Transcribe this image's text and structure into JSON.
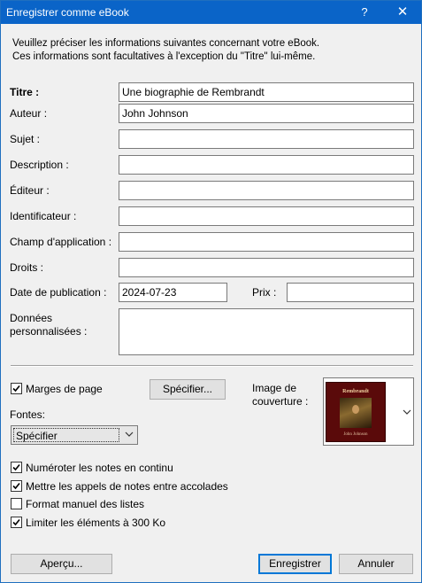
{
  "window": {
    "title": "Enregistrer comme eBook",
    "help_label": "?",
    "close_label": "✕"
  },
  "intro": {
    "line1": "Veuillez préciser les informations suivantes concernant votre eBook.",
    "line2": "Ces informations sont facultatives à l'exception du \"Titre\" lui-même."
  },
  "fields": {
    "titre": {
      "label": "Titre :",
      "value": "Une biographie de Rembrandt"
    },
    "auteur": {
      "label": "Auteur :",
      "value": "John Johnson"
    },
    "sujet": {
      "label": "Sujet :",
      "value": ""
    },
    "description": {
      "label": "Description :",
      "value": ""
    },
    "editeur": {
      "label": "Éditeur :",
      "value": ""
    },
    "identificateur": {
      "label": "Identificateur :",
      "value": ""
    },
    "champ": {
      "label": "Champ d'application :",
      "value": ""
    },
    "droits": {
      "label": "Droits :",
      "value": ""
    },
    "date": {
      "label": "Date de publication :",
      "value": "2024-07-23"
    },
    "prix": {
      "label": "Prix :",
      "value": ""
    },
    "donnees": {
      "label1": "Données",
      "label2": "personnalisées :",
      "value": ""
    }
  },
  "options": {
    "marges": {
      "label": "Marges de page",
      "checked": true
    },
    "specifier_button": "Spécifier...",
    "fontes_label": "Fontes:",
    "fontes_value": "Spécifier",
    "numeroter": {
      "label": "Numéroter les notes en continu",
      "checked": true
    },
    "accolades": {
      "label": "Mettre les appels de notes entre accolades",
      "checked": true
    },
    "format_listes": {
      "label": "Format manuel des listes",
      "checked": false
    },
    "limiter": {
      "label": "Limiter les éléments à 300 Ko",
      "checked": true
    }
  },
  "cover": {
    "label1": "Image de",
    "label2": "couverture :",
    "book_title": "Rembrandt",
    "book_author": "John Johnson"
  },
  "buttons": {
    "apercu": "Aperçu...",
    "enregistrer": "Enregistrer",
    "annuler": "Annuler"
  }
}
